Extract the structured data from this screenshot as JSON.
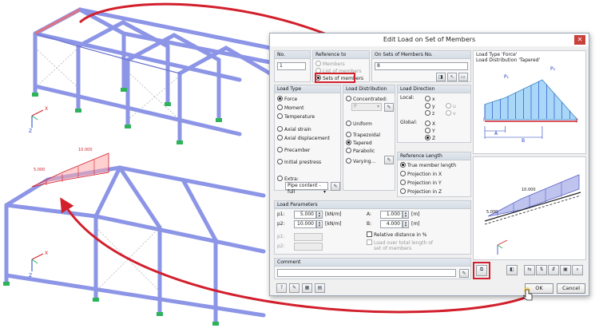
{
  "dialog": {
    "title": "Edit Load on Set of Members",
    "close_glyph": "✕",
    "no": {
      "label": "No.",
      "value": "1"
    },
    "reference_to": {
      "label": "Reference to",
      "options": [
        "Members",
        "List of members",
        "Sets of members"
      ],
      "selected": 2
    },
    "on_sets": {
      "label": "On Sets of Members No.",
      "value": "8"
    },
    "load_type": {
      "label": "Load Type",
      "options": [
        "Force",
        "Moment",
        "Temperature",
        "Axial strain",
        "Axial displacement",
        "Precamber",
        "Initial prestress",
        "Extra:"
      ],
      "selected": 0,
      "extra_value": "Pipe content - full"
    },
    "load_distribution": {
      "label": "Load Distribution",
      "options": [
        "Concentrated:",
        "Uniform",
        "Trapezoidal",
        "Tapered",
        "Parabolic",
        "Varying..."
      ],
      "selected": 3,
      "concentrated_value": "P"
    },
    "load_direction": {
      "label": "Load Direction",
      "local_label": "Local:",
      "local_options": [
        "x",
        "y",
        "z"
      ],
      "local_extra": [
        "u",
        "v"
      ],
      "global_label": "Global:",
      "global_options": [
        "X",
        "Y",
        "Z"
      ],
      "selected_global": 2
    },
    "reference_length": {
      "label": "Reference Length",
      "options": [
        "True member length",
        "Projection in X",
        "Projection in Y",
        "Projection in Z"
      ],
      "selected": 0
    },
    "preview": {
      "line1": "Load Type 'Force'",
      "line2": "Load Distribution 'Tapered'",
      "labels": {
        "p1": "P₁",
        "p2": "P₂",
        "i": "i",
        "j": "j",
        "a": "A",
        "b": "B"
      },
      "diagram": {
        "p1_height": 0.55,
        "p2_height": 1.0,
        "a_fraction": 0.22,
        "b_fraction": 0.62
      }
    },
    "load_parameters": {
      "label": "Load Parameters",
      "p1": {
        "label": "p1:",
        "value": "5.000",
        "unit": "[kN/m]"
      },
      "p2": {
        "label": "p2:",
        "value": "10.000",
        "unit": "[kN/m]"
      },
      "p1_lower": {
        "label": "p1:"
      },
      "p2_lower": {
        "label": "p2:"
      },
      "a": {
        "label": "A:",
        "value": "1.000",
        "unit": "[m]"
      },
      "b": {
        "label": "B:",
        "value": "4.000",
        "unit": "[m]"
      },
      "relative_distance": "Relative distance in %",
      "load_over_total_line1": "Load over total length of",
      "load_over_total_line2": "set of members"
    },
    "comment": {
      "label": "Comment",
      "value": ""
    },
    "mini_preview": {
      "label_p1": "5.000",
      "label_p2": "10.000"
    },
    "buttons": {
      "ok": "OK",
      "cancel": "Cancel"
    }
  },
  "model_labels": {
    "top_axis": {
      "x": "X",
      "z": "Z"
    },
    "bottom_axis": {
      "x": "X",
      "z": "Z"
    },
    "load_p2": "10.000",
    "load_p1": "5.000"
  },
  "colors": {
    "member": "#8c95e6",
    "member_dark": "#6d75cc",
    "support": "#2db35a",
    "highlight": "#d21f2c",
    "load": "#7f86d6"
  }
}
